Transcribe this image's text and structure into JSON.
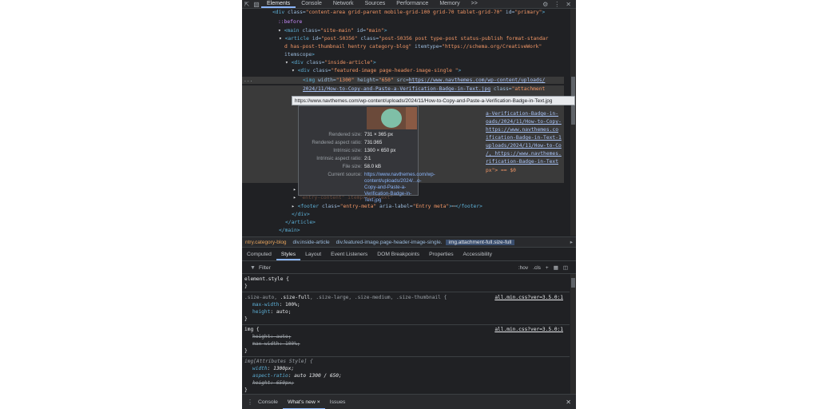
{
  "top_tabs": [
    "Elements",
    "Console",
    "Network",
    "Sources",
    "Performance",
    "Memory"
  ],
  "top_more": ">>",
  "top_icons": [
    "inspect-icon",
    "device-toggle-icon",
    "settings-icon",
    "more-icon",
    "close-icon"
  ],
  "dom": {
    "l1": {
      "tag": "<div ",
      "a1": "class=",
      "v1": "\"content-area grid-parent mobile-grid-100 grid-70 tablet-grid-70\"",
      "a2": " id=",
      "v2": "\"primary\"",
      "end": ">"
    },
    "l2": "::before",
    "l3": {
      "tag": "<main ",
      "a1": "class=",
      "v1": "\"site-main\"",
      "a2": " id=",
      "v2": "\"main\"",
      "end": ">"
    },
    "l4": {
      "tag": "<article ",
      "a1": "id=",
      "v1": "\"post-50356\"",
      "a2": " class=",
      "v2": "\"post-50356 post type-post status-publish format-standar"
    },
    "l5": {
      "v": "d has-post-thumbnail hentry category-blog\"",
      "a": " itemtype=",
      "v2": "\"https://schema.org/CreativeWork\""
    },
    "l6": {
      "a": "itemscope",
      "end": ">"
    },
    "l7": {
      "tag": "<div ",
      "a1": "class=",
      "v1": "\"inside-article\"",
      "end": ">"
    },
    "l8": {
      "tag": "<div ",
      "a1": "class=",
      "v1": "\"featured-image  page-header-image-single \"",
      "end": ">"
    },
    "l9": {
      "tag": "<img ",
      "a1": "width=",
      "v1": "\"1300\"",
      "a2": " height=",
      "v2": "\"650\"",
      "a3": " src=",
      "link": "https://www.navthemes.com/wp-content/uploads/"
    },
    "l10": {
      "link": "2024/11/How-to-Copy-and-Paste-a-Verification-Badge-in-Text.jpg",
      "a": " class=",
      "v": "\"attachment"
    },
    "r1": "a-Verification-Badge-in-",
    "r2": "oads/2024/11/How-to-Copy-",
    "r3": "https://www.navthemes.co",
    "r4": "ification-Badge-in-Text-1",
    "r5": "uploads/2024/11/How-to-Co",
    "r6": "/, https://www.navthemes.",
    "r7": "rification-Badge-in-Text",
    "r8": "px\"> == $0",
    "after1": "\"entry-content\"  itemprop=\"text\"",
    "footer": {
      "tag": "<footer ",
      "a1": "class=",
      "v1": "\"entry-meta\"",
      "a2": " aria-label=",
      "v2": "\"Entry meta\"",
      "end": ">",
      "ell": "⋯",
      "close": "</footer>"
    },
    "close_div": "</div>",
    "close_article": "</article>",
    "close_main": "</main>",
    "gutter": "..."
  },
  "url_tooltip": "https://www.navthemes.com/wp-content/uploads/2024/11/How-to-Copy-and-Paste-a-Verification-Badge-in-Text.jpg",
  "image_popover": {
    "rows": [
      {
        "k": "Rendered size:",
        "v": "731 × 365 px"
      },
      {
        "k": "Rendered aspect ratio:",
        "v": "731∶365"
      },
      {
        "k": "Intrinsic size:",
        "v": "1300 × 650 px"
      },
      {
        "k": "Intrinsic aspect ratio:",
        "v": "2∶1"
      },
      {
        "k": "File size:",
        "v": "58.0 kB"
      },
      {
        "k": "Current source:",
        "v": "https://www.navthemes.com/wp-content/uploads/2024/...o-Copy-and-Paste-a-Verification-Badge-in-Text.jpg"
      }
    ]
  },
  "breadcrumbs": [
    {
      "label": "ntry.category-blog"
    },
    {
      "label": "div.inside-article"
    },
    {
      "label": "div.featured-image.page-header-image-single."
    },
    {
      "label": "img.attachment-full.size-full"
    }
  ],
  "panel_tabs": [
    "Computed",
    "Styles",
    "Layout",
    "Event Listeners",
    "DOM Breakpoints",
    "Properties",
    "Accessibility"
  ],
  "filter": {
    "placeholder": "Filter",
    "hov": ":hov",
    "cls": ".cls"
  },
  "styles": {
    "element_style": "element.style {",
    "close": "}",
    "rule1": {
      "sel1": ".size-auto, ",
      "sel2": ".size-full",
      "sel3": ", .size-large, .size-medium, .size-thumbnail {",
      "src": "all.min.css?ver=3.5.0:1",
      "p1": "max-width",
      "v1": "100%;",
      "p2": "height",
      "v2": "auto;"
    },
    "rule2": {
      "sel": "img {",
      "src": "all.min.css?ver=3.5.0:1",
      "p1": "height: auto;",
      "p2": "max-width: 100%;"
    },
    "rule3": {
      "sel": "img[Attributes Style] {",
      "p1": "width",
      "v1": "1300px;",
      "p2": "aspect-ratio",
      "v2": "auto 1300 / 650;",
      "p3": "height: 650px;"
    }
  },
  "drawer_tabs": [
    "Console",
    "What's new",
    "Issues"
  ],
  "drawer_close_x": "×",
  "colors": {
    "panel_bg": "#202124",
    "accent": "#8ab4f8",
    "tag": "#5db0d7",
    "attr_value": "#f29766"
  }
}
